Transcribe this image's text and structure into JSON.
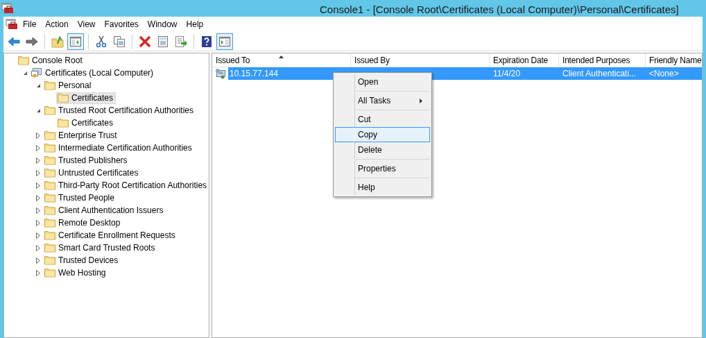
{
  "window": {
    "title": "Console1 - [Console Root\\Certificates (Local Computer)\\Personal\\Certificates]"
  },
  "menu_bar": [
    "File",
    "Action",
    "View",
    "Favorites",
    "Window",
    "Help"
  ],
  "toolbar": [
    {
      "kind": "back",
      "pressed": false
    },
    {
      "kind": "forward",
      "pressed": false
    },
    {
      "kind": "separator"
    },
    {
      "kind": "up",
      "pressed": false
    },
    {
      "kind": "tree",
      "pressed": true
    },
    {
      "kind": "separator"
    },
    {
      "kind": "cut",
      "pressed": false
    },
    {
      "kind": "copy",
      "pressed": false
    },
    {
      "kind": "separator"
    },
    {
      "kind": "delete",
      "pressed": false
    },
    {
      "kind": "properties",
      "pressed": false
    },
    {
      "kind": "export",
      "pressed": false
    },
    {
      "kind": "separator"
    },
    {
      "kind": "help",
      "pressed": false
    },
    {
      "kind": "pane",
      "pressed": true
    }
  ],
  "tree": [
    {
      "label": "Console Root",
      "kind": "folder",
      "selected": false,
      "children": [
        {
          "label": "Certificates (Local Computer)",
          "kind": "store",
          "selected": false,
          "expanded": true,
          "children": [
            {
              "label": "Personal",
              "kind": "folder",
              "selected": false,
              "expanded": true,
              "children": [
                {
                  "label": "Certificates",
                  "kind": "folder",
                  "selected": true
                }
              ]
            },
            {
              "label": "Trusted Root Certification Authorities",
              "kind": "folder",
              "selected": false,
              "expanded": true,
              "children": [
                {
                  "label": "Certificates",
                  "kind": "folder",
                  "selected": false
                }
              ]
            },
            {
              "label": "Enterprise Trust",
              "kind": "folder",
              "selected": false,
              "expanded": false
            },
            {
              "label": "Intermediate Certification Authorities",
              "kind": "folder",
              "selected": false,
              "expanded": false
            },
            {
              "label": "Trusted Publishers",
              "kind": "folder",
              "selected": false,
              "expanded": false
            },
            {
              "label": "Untrusted Certificates",
              "kind": "folder",
              "selected": false,
              "expanded": false
            },
            {
              "label": "Third-Party Root Certification Authorities",
              "kind": "folder",
              "selected": false,
              "expanded": false
            },
            {
              "label": "Trusted People",
              "kind": "folder",
              "selected": false,
              "expanded": false
            },
            {
              "label": "Client Authentication Issuers",
              "kind": "folder",
              "selected": false,
              "expanded": false
            },
            {
              "label": "Remote Desktop",
              "kind": "folder",
              "selected": false,
              "expanded": false
            },
            {
              "label": "Certificate Enrollment Requests",
              "kind": "folder",
              "selected": false,
              "expanded": false
            },
            {
              "label": "Smart Card Trusted Roots",
              "kind": "folder",
              "selected": false,
              "expanded": false
            },
            {
              "label": "Trusted Devices",
              "kind": "folder",
              "selected": false,
              "expanded": false
            },
            {
              "label": "Web Hosting",
              "kind": "folder",
              "selected": false,
              "expanded": false
            }
          ]
        }
      ]
    }
  ],
  "table": {
    "columns": [
      {
        "label": "Issued To",
        "sorted": true
      },
      {
        "label": "Issued By",
        "sorted": false
      },
      {
        "label": "Expiration Date",
        "sorted": false
      },
      {
        "label": "Intended Purposes",
        "sorted": false
      },
      {
        "label": "Friendly Name",
        "sorted": false
      }
    ],
    "rows": [
      {
        "selected": true,
        "cells": [
          "10.15.77.144",
          null,
          "11/4/20",
          "Client Authenticati...",
          "<None>"
        ]
      }
    ]
  },
  "context_menu": [
    {
      "kind": "item",
      "label": "Open",
      "selected": false,
      "submenu": false
    },
    {
      "kind": "separator"
    },
    {
      "kind": "item",
      "label": "All Tasks",
      "selected": false,
      "submenu": true
    },
    {
      "kind": "separator"
    },
    {
      "kind": "item",
      "label": "Cut",
      "selected": false,
      "submenu": false
    },
    {
      "kind": "item",
      "label": "Copy",
      "selected": true,
      "submenu": false
    },
    {
      "kind": "item",
      "label": "Delete",
      "selected": false,
      "submenu": false
    },
    {
      "kind": "separator"
    },
    {
      "kind": "item",
      "label": "Properties",
      "selected": false,
      "submenu": false
    },
    {
      "kind": "separator"
    },
    {
      "kind": "item",
      "label": "Help",
      "selected": false,
      "submenu": false
    }
  ]
}
